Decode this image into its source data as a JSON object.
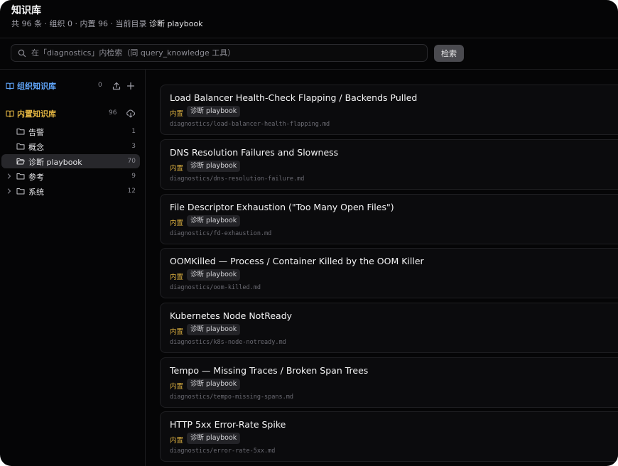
{
  "header": {
    "title": "知识库",
    "stats": "共 96 条 · 组织 0 · 内置 96 · 当前目录",
    "current_dir": "诊断 playbook"
  },
  "search": {
    "placeholder": "在「diagnostics」内检索（同 query_knowledge 工具）",
    "value": "",
    "button_label": "检索"
  },
  "sidebar": {
    "org": {
      "label": "组织知识库",
      "count": "0",
      "color": "#60a5fa"
    },
    "builtin": {
      "label": "内置知识库",
      "count": "96",
      "color": "#e0b341"
    },
    "folders": [
      {
        "name": "告警",
        "count": "1",
        "expandable": false,
        "active": false
      },
      {
        "name": "概念",
        "count": "3",
        "expandable": false,
        "active": false
      },
      {
        "name": "诊断 playbook",
        "count": "70",
        "expandable": false,
        "active": true
      },
      {
        "name": "参考",
        "count": "9",
        "expandable": true,
        "active": false
      },
      {
        "name": "系统",
        "count": "12",
        "expandable": true,
        "active": false
      }
    ]
  },
  "cards": [
    {
      "title": "Load Balancer Health-Check Flapping / Backends Pulled",
      "builtin": "内置",
      "tag": "诊断 playbook",
      "path": "diagnostics/load-balancer-health-flapping.md"
    },
    {
      "title": "DNS Resolution Failures and Slowness",
      "builtin": "内置",
      "tag": "诊断 playbook",
      "path": "diagnostics/dns-resolution-failure.md"
    },
    {
      "title": "File Descriptor Exhaustion (\"Too Many Open Files\")",
      "builtin": "内置",
      "tag": "诊断 playbook",
      "path": "diagnostics/fd-exhaustion.md"
    },
    {
      "title": "OOMKilled — Process / Container Killed by the OOM Killer",
      "builtin": "内置",
      "tag": "诊断 playbook",
      "path": "diagnostics/oom-killed.md"
    },
    {
      "title": "Kubernetes Node NotReady",
      "builtin": "内置",
      "tag": "诊断 playbook",
      "path": "diagnostics/k8s-node-notready.md"
    },
    {
      "title": "Tempo — Missing Traces / Broken Span Trees",
      "builtin": "内置",
      "tag": "诊断 playbook",
      "path": "diagnostics/tempo-missing-spans.md"
    },
    {
      "title": "HTTP 5xx Error-Rate Spike",
      "builtin": "内置",
      "tag": "诊断 playbook",
      "path": "diagnostics/error-rate-5xx.md"
    }
  ]
}
